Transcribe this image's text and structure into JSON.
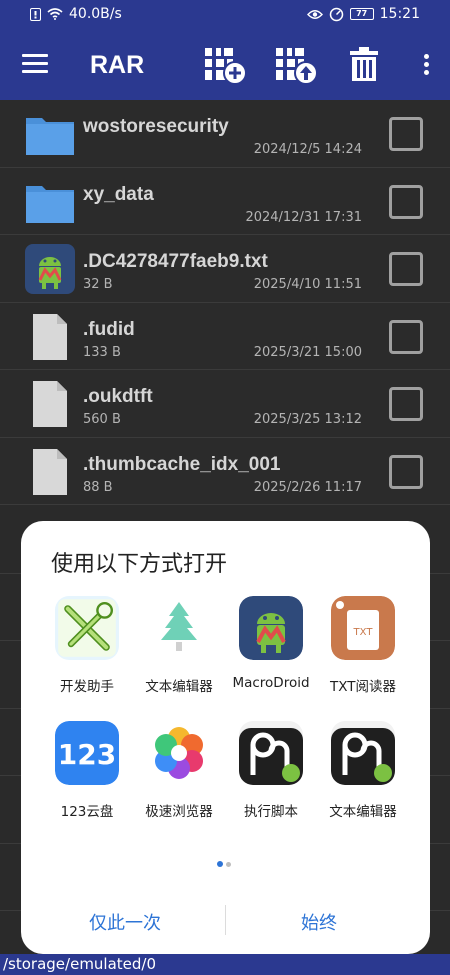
{
  "status_bar": {
    "network_speed": "40.0B/s",
    "battery": "77",
    "time": "15:21"
  },
  "app_bar": {
    "title": "RAR"
  },
  "files": [
    {
      "name": "wostoresecurity",
      "size": "",
      "date": "2024/12/5 14:24",
      "type": "folder"
    },
    {
      "name": "xy_data",
      "size": "",
      "date": "2024/12/31 17:31",
      "type": "folder"
    },
    {
      "name": ".DC4278477faeb9.txt",
      "size": "32 B",
      "date": "2025/4/10 11:51",
      "type": "app"
    },
    {
      "name": ".fudid",
      "size": "133 B",
      "date": "2025/3/21 15:00",
      "type": "file"
    },
    {
      "name": ".oukdtft",
      "size": "560 B",
      "date": "2025/3/25 13:12",
      "type": "file"
    },
    {
      "name": ".thumbcache_idx_001",
      "size": "88 B",
      "date": "2025/2/26 11:17",
      "type": "file"
    }
  ],
  "open_with": {
    "title": "使用以下方式打开",
    "apps": [
      {
        "label": "开发助手",
        "icon": "wrench-screwdriver-icon"
      },
      {
        "label": "文本编辑器",
        "icon": "tree-icon"
      },
      {
        "label": "MacroDroid",
        "icon": "macrodroid-icon"
      },
      {
        "label": "TXT阅读器",
        "icon": "txt-reader-icon"
      },
      {
        "label": "123云盘",
        "icon": "cloud-123-icon"
      },
      {
        "label": "极速浏览器",
        "icon": "browser-flower-icon"
      },
      {
        "label": "执行脚本",
        "icon": "script-icon"
      },
      {
        "label": "文本编辑器",
        "icon": "text-editor-icon"
      }
    ],
    "just_once": "仅此一次",
    "always": "始终"
  },
  "path": "/storage/emulated/0",
  "colors": {
    "primary": "#2b3990",
    "accent": "#2d74d6",
    "folder": "#4a90d9"
  }
}
